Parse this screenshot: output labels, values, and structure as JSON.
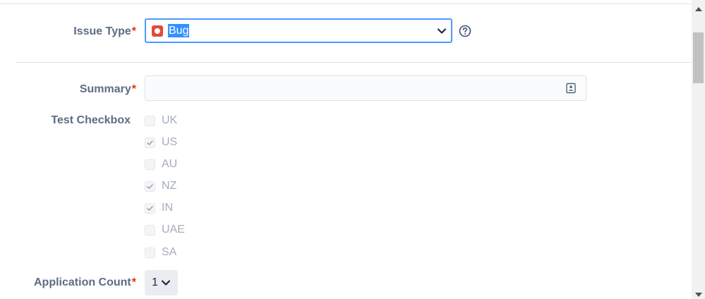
{
  "form": {
    "issue_type": {
      "label": "Issue Type",
      "required_mark": "*",
      "value": "Bug",
      "icon": "bug-icon"
    },
    "summary": {
      "label": "Summary",
      "required_mark": "*",
      "value": ""
    },
    "test_checkbox": {
      "label": "Test Checkbox",
      "options": [
        {
          "label": "UK",
          "checked": false
        },
        {
          "label": "US",
          "checked": true
        },
        {
          "label": "AU",
          "checked": false
        },
        {
          "label": "NZ",
          "checked": true
        },
        {
          "label": "IN",
          "checked": true
        },
        {
          "label": "UAE",
          "checked": false
        },
        {
          "label": "SA",
          "checked": false
        }
      ]
    },
    "application_count": {
      "label": "Application Count",
      "required_mark": "*",
      "value": "1"
    }
  },
  "colors": {
    "bug_red": "#e5493a",
    "focus_border": "#4c9aff",
    "selection_blue": "#3390ff",
    "required_red": "#de350b"
  }
}
